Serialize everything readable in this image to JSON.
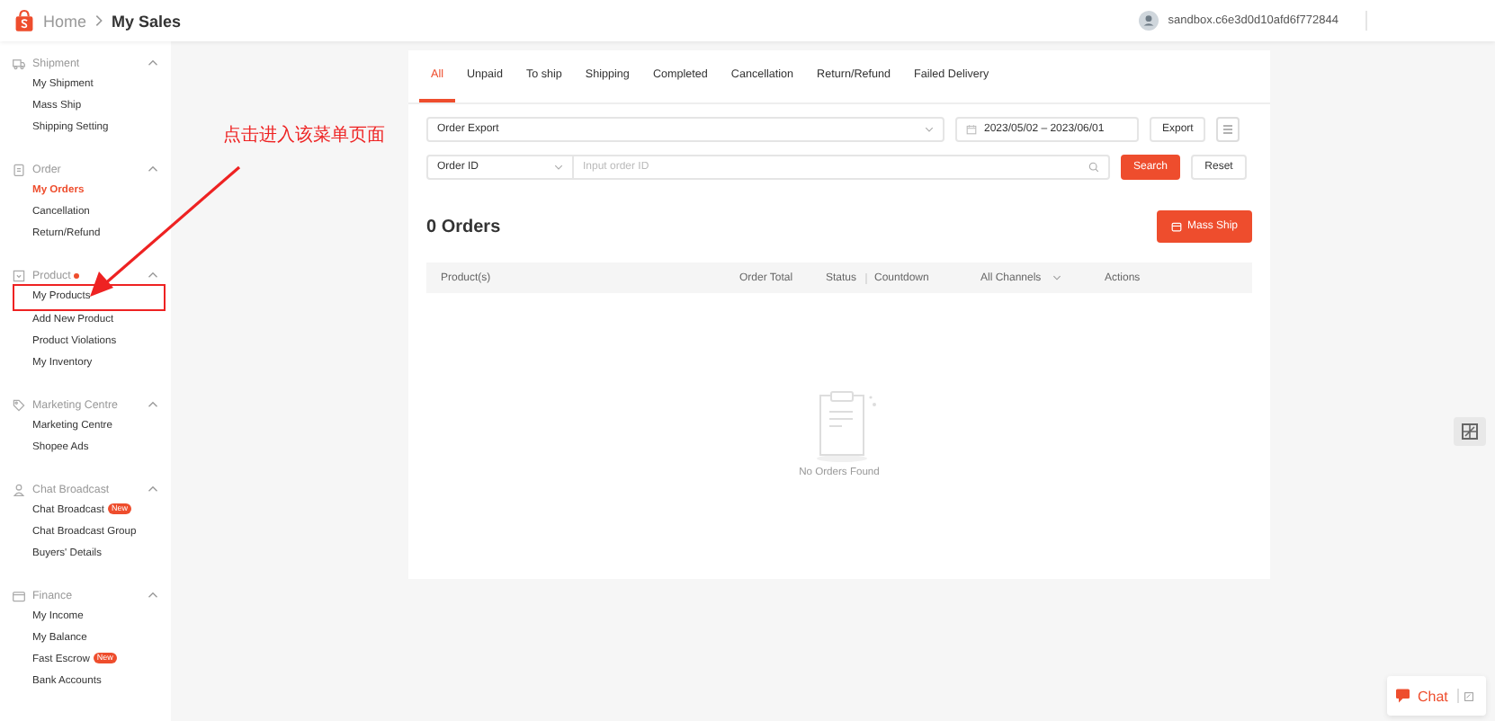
{
  "header": {
    "breadcrumb": [
      {
        "label": "Home"
      },
      {
        "label": "My Sales"
      }
    ],
    "account": "sandbox.c6e3d0d10afd6f772844"
  },
  "sidebar": {
    "groups": [
      {
        "title": "Shipment",
        "dot": false,
        "expanded": true,
        "items": [
          {
            "label": "My Shipment",
            "selected": false,
            "highlighted": false
          },
          {
            "label": "Mass Ship",
            "selected": false,
            "highlighted": false
          },
          {
            "label": "Shipping Setting",
            "selected": false,
            "highlighted": false
          }
        ]
      },
      {
        "title": "Order",
        "dot": false,
        "expanded": true,
        "items": [
          {
            "label": "My Orders",
            "selected": true,
            "highlighted": false
          },
          {
            "label": "Cancellation",
            "selected": false,
            "highlighted": false
          },
          {
            "label": "Return/Refund",
            "selected": false,
            "highlighted": false
          }
        ]
      },
      {
        "title": "Product",
        "dot": true,
        "expanded": true,
        "items": [
          {
            "label": "My Products",
            "selected": false,
            "highlighted": true
          },
          {
            "label": "Add New Product",
            "selected": false,
            "highlighted": false
          },
          {
            "label": "Product Violations",
            "selected": false,
            "highlighted": false
          },
          {
            "label": "My Inventory",
            "selected": false,
            "highlighted": false
          }
        ]
      },
      {
        "title": "Marketing Centre",
        "dot": false,
        "expanded": true,
        "items": [
          {
            "label": "Marketing Centre",
            "selected": false,
            "highlighted": false
          },
          {
            "label": "Shopee Ads",
            "selected": false,
            "highlighted": false
          }
        ]
      },
      {
        "title": "Chat Broadcast",
        "dot": false,
        "expanded": true,
        "items": [
          {
            "label": "Chat Broadcast",
            "badge": "New",
            "selected": false,
            "highlighted": false
          },
          {
            "label": "Chat Broadcast Group",
            "selected": false,
            "highlighted": false
          },
          {
            "label": "Buyers' Details",
            "selected": false,
            "highlighted": false
          }
        ]
      },
      {
        "title": "Finance",
        "dot": false,
        "expanded": true,
        "items": [
          {
            "label": "My Income",
            "selected": false,
            "highlighted": false
          },
          {
            "label": "My Balance",
            "selected": false,
            "highlighted": false
          },
          {
            "label": "Fast Escrow",
            "badge": "New",
            "selected": false,
            "highlighted": false
          },
          {
            "label": "Bank Accounts",
            "selected": false,
            "highlighted": false
          }
        ]
      }
    ]
  },
  "annotation": {
    "text": "点击进入该菜单页面"
  },
  "tabs": [
    {
      "label": "All",
      "selected": true
    },
    {
      "label": "Unpaid",
      "selected": false
    },
    {
      "label": "To ship",
      "selected": false
    },
    {
      "label": "Shipping",
      "selected": false
    },
    {
      "label": "Completed",
      "selected": false
    },
    {
      "label": "Cancellation",
      "selected": false
    },
    {
      "label": "Return/Refund",
      "selected": false
    },
    {
      "label": "Failed Delivery",
      "selected": false
    }
  ],
  "filters": {
    "export_select": {
      "value": "Order Export"
    },
    "date_range": {
      "value": "2023/05/02 – 2023/06/01"
    },
    "export_button": "Export",
    "search_type": {
      "value": "Order ID"
    },
    "search_field": {
      "placeholder": "Input order ID"
    },
    "search_button": "Search",
    "reset_button": "Reset"
  },
  "orders": {
    "count": "0 Orders",
    "mass_ship_button": "Mass Ship"
  },
  "table": {
    "columns": [
      {
        "label": "Product(s)"
      },
      {
        "label": "Order Total"
      },
      {
        "label": "Status"
      },
      {
        "label": "Countdown"
      },
      {
        "label": "All Channels",
        "dropdown": true
      },
      {
        "label": "Actions"
      }
    ],
    "empty_text": "No Orders Found"
  },
  "chat": {
    "label": "Chat"
  }
}
